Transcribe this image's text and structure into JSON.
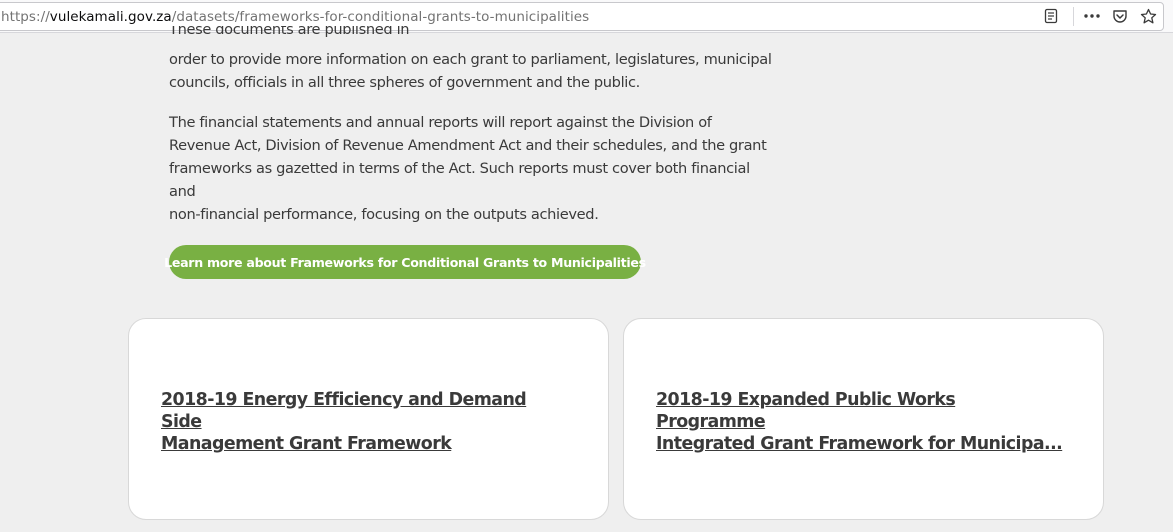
{
  "browser": {
    "url_scheme": "https://",
    "url_host": "vulekamali.gov.za",
    "url_path": "/datasets/frameworks-for-conditional-grants-to-municipalities",
    "icons": [
      "reader-view-icon",
      "more-actions-icon",
      "pocket-icon",
      "bookmark-star-icon"
    ]
  },
  "intro": {
    "para1_cut_line": "These documents are published in",
    "para1_line2": "order to provide more information on each grant to parliament, legislatures, municipal",
    "para1_line3": "councils, officials in all three spheres of government and the public.",
    "para2_line1": "The financial statements and annual reports will report against the Division of",
    "para2_line2": "Revenue Act, Division of Revenue Amendment Act and their schedules, and the grant",
    "para2_line3": "frameworks as gazetted in terms of the Act. Such reports must cover both financial and",
    "para2_line4": "non-financial performance, focusing on the outputs achieved."
  },
  "learn_more_button": "Learn more about Frameworks for Conditional Grants to Municipalities",
  "cards": [
    {
      "title_line1": "2018-19 Energy Efficiency and Demand Side",
      "title_line2": "Management Grant Framework"
    },
    {
      "title_line1": "2018-19 Expanded Public Works Programme",
      "title_line2": "Integrated Grant Framework for Municipa..."
    }
  ],
  "colors": {
    "accent_green": "#79b043",
    "page_background": "#efefef",
    "text": "#3a3a3a"
  }
}
